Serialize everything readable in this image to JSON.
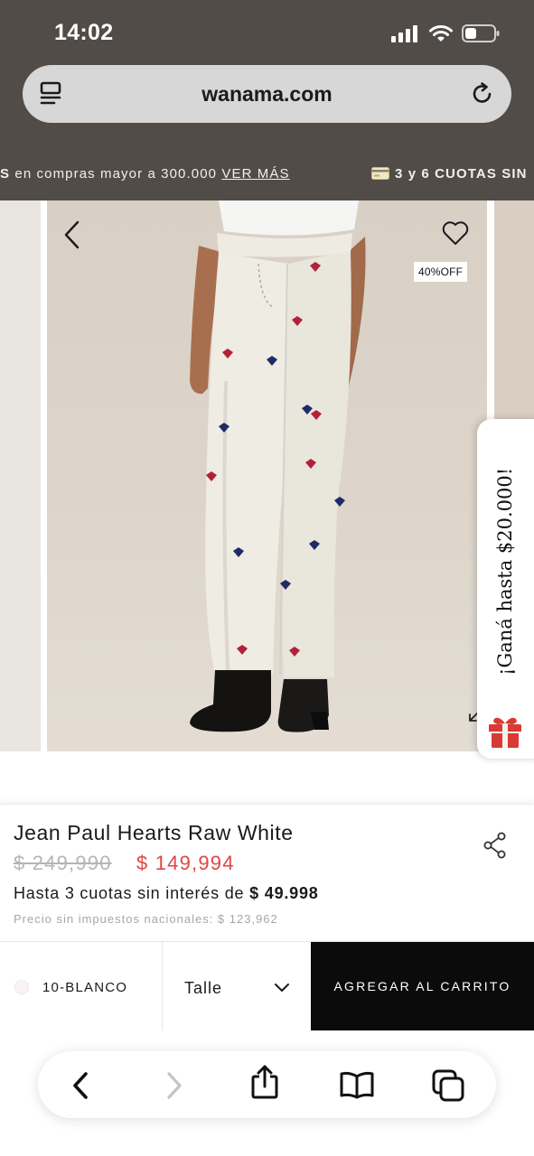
{
  "status_bar": {
    "time": "14:02",
    "icons": [
      "cellular-signal-icon",
      "wifi-icon",
      "battery-icon"
    ]
  },
  "browser": {
    "url": "wanama.com",
    "left_icon": "tabs-overview-icon",
    "right_icon": "reload-icon"
  },
  "promo_strip": {
    "lead": "S",
    "text": " en compras mayor a 300.000 ",
    "link": "VER MÁS ",
    "second_icon": "credit-card-icon",
    "second_text": "3 y 6 CUOTAS SIN"
  },
  "gallery": {
    "badge": "40%OFF",
    "icons": [
      "chevron-left-icon",
      "heart-icon",
      "expand-icon"
    ]
  },
  "side_promo": {
    "text": "¡Ganá hasta $20.000!",
    "icon": "gift-icon"
  },
  "product": {
    "title": "Jean Paul Hearts Raw White",
    "price_old": "$ 249,990 ",
    "price_new": "$ 149,994",
    "installments_text": "Hasta 3 cuotas sin interés de ",
    "installments_amount": "$ 49.998",
    "tax_note": "Precio sin impuestos nacionales: $ 123,962"
  },
  "buy_bar": {
    "color_label": "10-BLANCO",
    "size_label": "Talle",
    "cart_label": "AGREGAR AL CARRITO"
  },
  "toolbar": {
    "icons": [
      "back-icon",
      "forward-icon",
      "share-icon",
      "bookmarks-icon",
      "tabs-icon"
    ]
  },
  "colors": {
    "chrome_bg": "#514c48",
    "sale_red": "#e04545",
    "cart_bg": "#0b0b0b",
    "gift_red": "#d83a35"
  }
}
